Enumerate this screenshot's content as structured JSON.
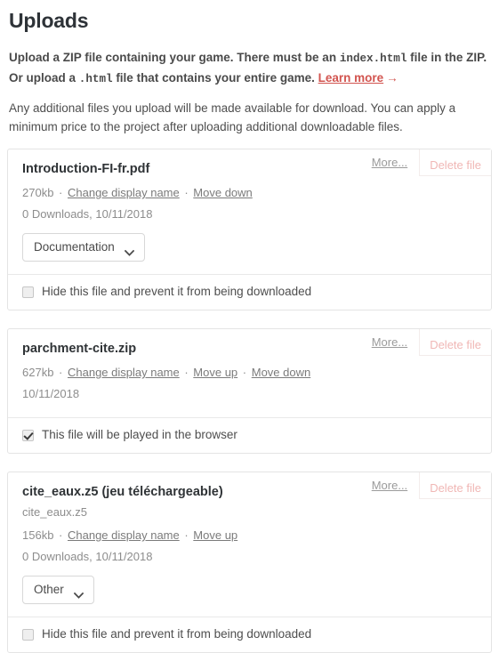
{
  "page": {
    "title": "Uploads",
    "intro_strong_pre": "Upload a ZIP file containing your game. There must be an ",
    "intro_code_1": "index.html",
    "intro_strong_mid": " file in the ZIP. Or upload a ",
    "intro_code_2": ".html",
    "intro_strong_post": " file that contains your entire game. ",
    "learn_more_label": "Learn more",
    "learn_more_arrow": "→",
    "intro_normal": "Any additional files you upload will be made available for download. You can apply a minimum price to the project after uploading additional downloadable files."
  },
  "colors": {
    "link_red": "#d2544f",
    "delete_pink": "#f0b7b5",
    "meta_gray": "#8d8d8d",
    "card_border": "#e4e4e4"
  },
  "actions": {
    "more_label": "More...",
    "delete_label": "Delete file"
  },
  "files": [
    {
      "name": "Introduction-FI-fr.pdf",
      "subname": "",
      "size": "270kb",
      "links": [
        "Change display name",
        "Move down"
      ],
      "stats": "0 Downloads, 10/11/2018",
      "select_label": "Documentation",
      "has_select": true,
      "footer_label": "Hide this file and prevent it from being downloaded",
      "footer_checked": false
    },
    {
      "name": "parchment-cite.zip",
      "subname": "",
      "size": "627kb",
      "links": [
        "Change display name",
        "Move up",
        "Move down"
      ],
      "stats": "10/11/2018",
      "select_label": "",
      "has_select": false,
      "footer_label": "This file will be played in the browser",
      "footer_checked": true
    },
    {
      "name": "cite_eaux.z5 (jeu téléchargeable)",
      "subname": "cite_eaux.z5",
      "size": "156kb",
      "links": [
        "Change display name",
        "Move up"
      ],
      "stats": "0 Downloads, 10/11/2018",
      "select_label": "Other",
      "has_select": true,
      "footer_label": "Hide this file and prevent it from being downloaded",
      "footer_checked": false
    }
  ]
}
